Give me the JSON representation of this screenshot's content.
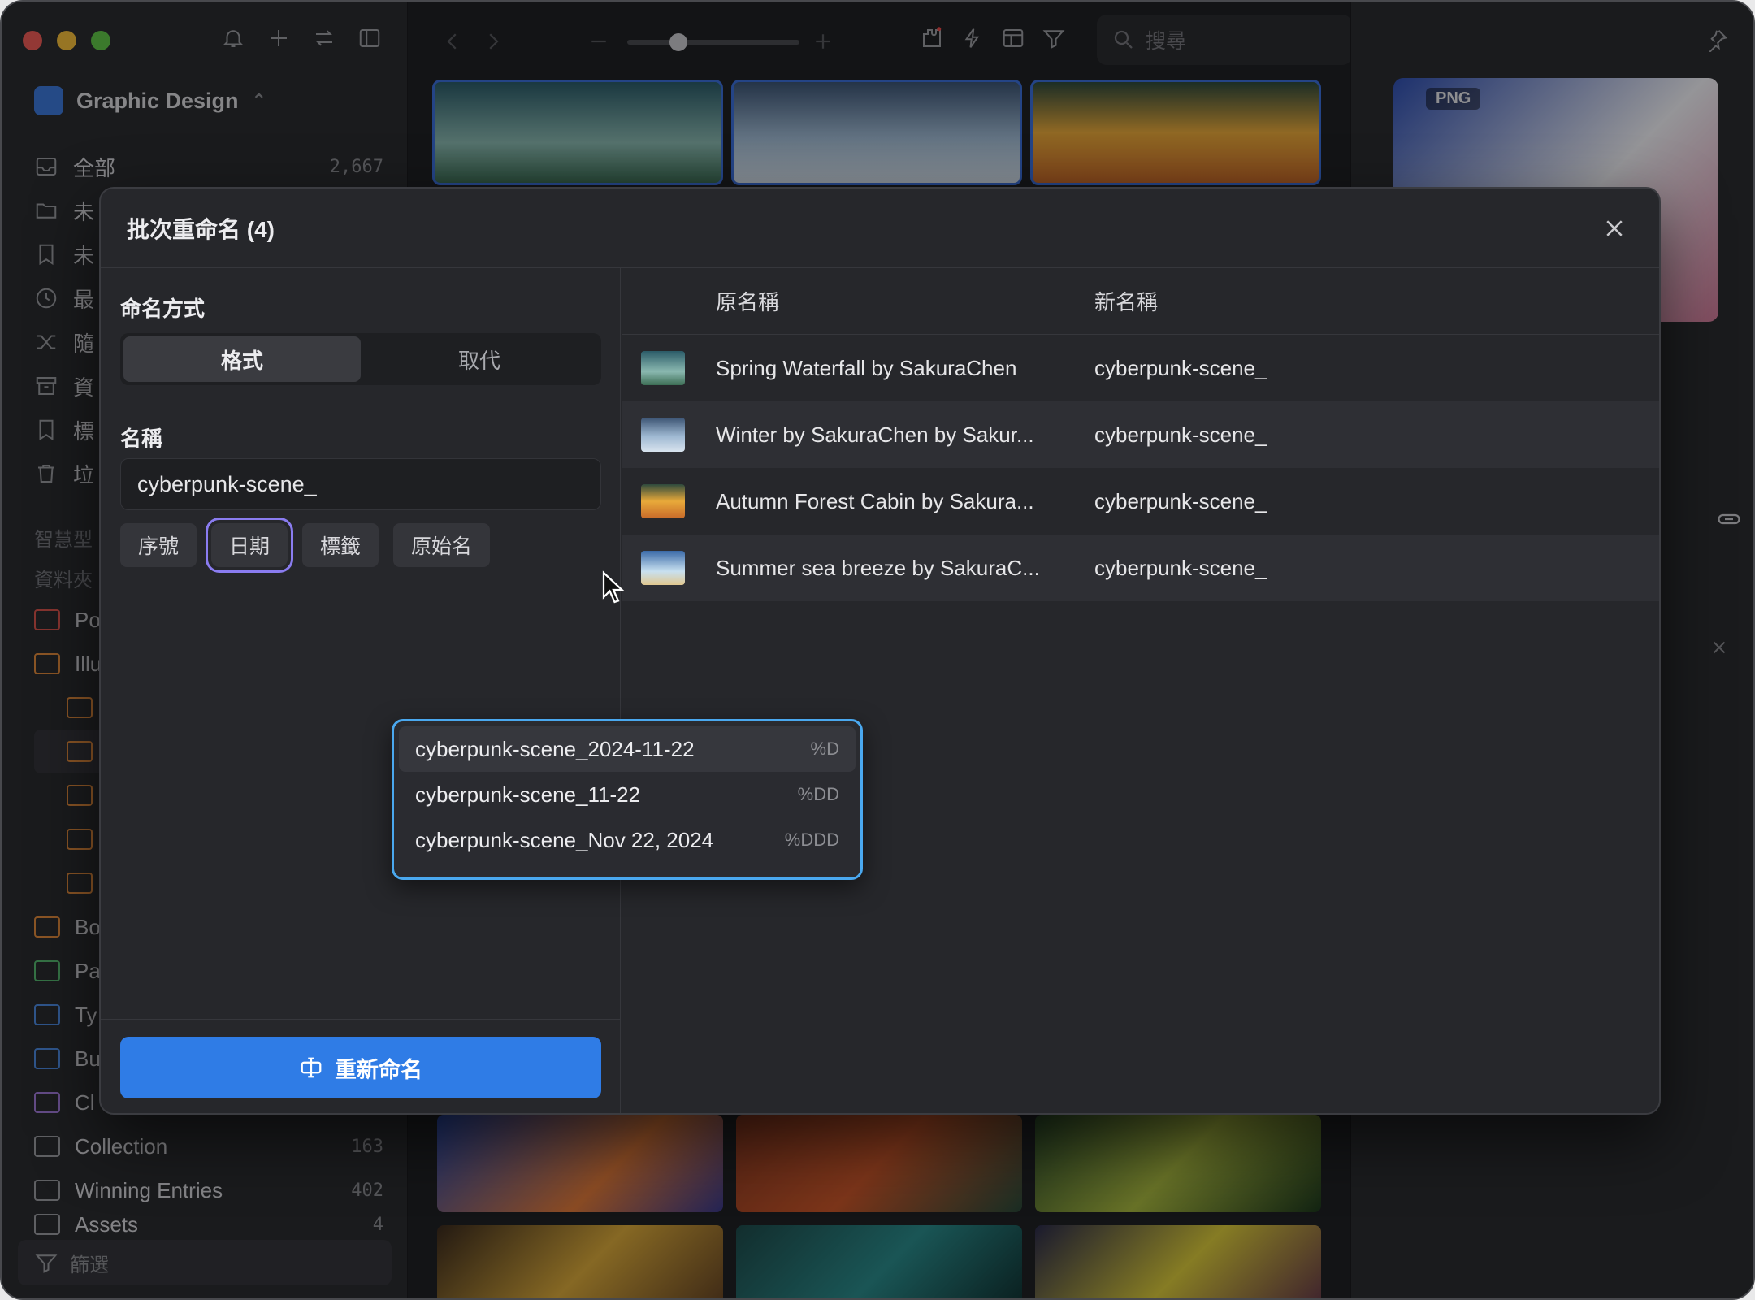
{
  "sidebar": {
    "library_name": "Graphic Design",
    "items": [
      {
        "label": "全部",
        "count": "2,667"
      },
      {
        "label": "未"
      },
      {
        "label": "未"
      },
      {
        "label": "最"
      },
      {
        "label": "隨"
      },
      {
        "label": "資"
      },
      {
        "label": "標"
      },
      {
        "label": "垃"
      }
    ],
    "section_smart": "智慧型",
    "section_folders": "資料夾",
    "folders_top": [
      "Po",
      "Illu"
    ],
    "folders_mid": [
      "Bo",
      "Pa",
      "Ty",
      "Bu",
      "Cl"
    ],
    "folders_bottom": [
      {
        "label": "Collection",
        "count": "163"
      },
      {
        "label": "Winning Entries",
        "count": "402"
      },
      {
        "label": "Assets",
        "count": "4"
      }
    ],
    "filter_label": "篩選"
  },
  "toolbar": {
    "search_placeholder": "搜尋"
  },
  "preview": {
    "format_badge": "PNG"
  },
  "modal": {
    "title": "批次重命名 (4)",
    "method_label": "命名方式",
    "tabs": [
      "格式",
      "取代"
    ],
    "name_label": "名稱",
    "name_value": "cyberpunk-scene_",
    "chips": [
      "序號",
      "日期",
      "標籤",
      "原始名"
    ],
    "rename_button": "重新命名",
    "columns": {
      "original": "原名稱",
      "new": "新名稱"
    },
    "rows": [
      {
        "original": "Spring Waterfall by SakuraChen",
        "new": "cyberpunk-scene_"
      },
      {
        "original": "Winter by SakuraChen by Sakur...",
        "new": "cyberpunk-scene_"
      },
      {
        "original": "Autumn Forest Cabin by Sakura...",
        "new": "cyberpunk-scene_"
      },
      {
        "original": "Summer sea breeze by SakuraC...",
        "new": "cyberpunk-scene_"
      }
    ]
  },
  "dropdown": {
    "items": [
      {
        "label": "cyberpunk-scene_2024-11-22",
        "format": "%D"
      },
      {
        "label": "cyberpunk-scene_11-22",
        "format": "%DD"
      },
      {
        "label": "cyberpunk-scene_Nov 22, 2024",
        "format": "%DDD"
      }
    ]
  },
  "colors": {
    "accent": "#2f7ce6",
    "dropdown_border": "#4aa8ef",
    "chip_highlight": "#8a7cf0"
  }
}
